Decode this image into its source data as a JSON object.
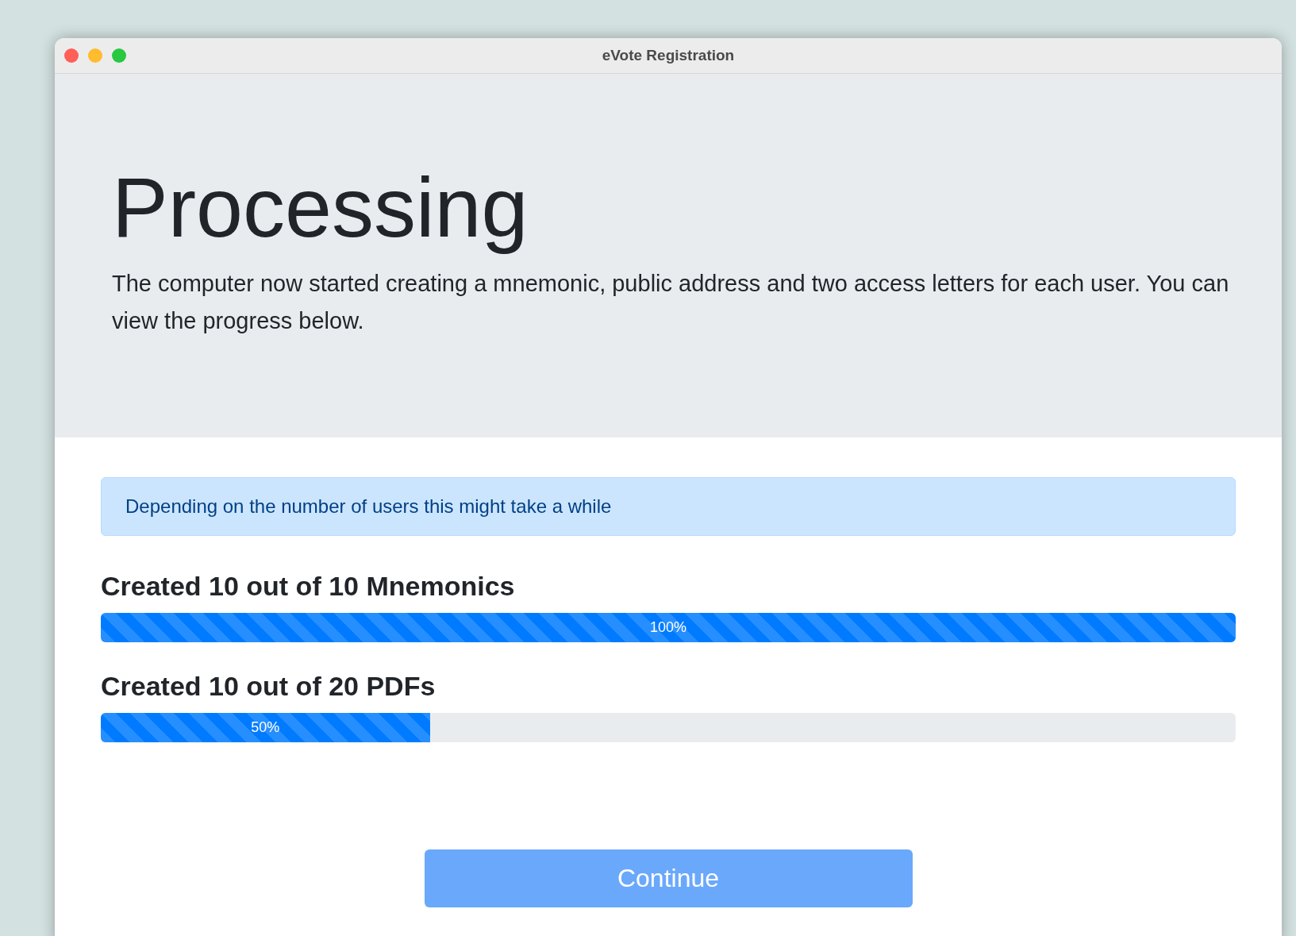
{
  "window": {
    "title": "eVote Registration"
  },
  "header": {
    "title": "Processing",
    "text": "The computer now started creating a mnemonic, public address and two access letters for each user. You can view the progress below."
  },
  "alert": "Depending on the number of users this might take a while",
  "progress": [
    {
      "label": "Created 10 out of 10 Mnemonics",
      "level": 1,
      "reading": "100%"
    },
    {
      "label": "Created 10 out of 20 PDFs",
      "level": 0.29,
      "reading": "50%"
    }
  ],
  "button": {
    "label": "Continue",
    "disabled": true
  }
}
